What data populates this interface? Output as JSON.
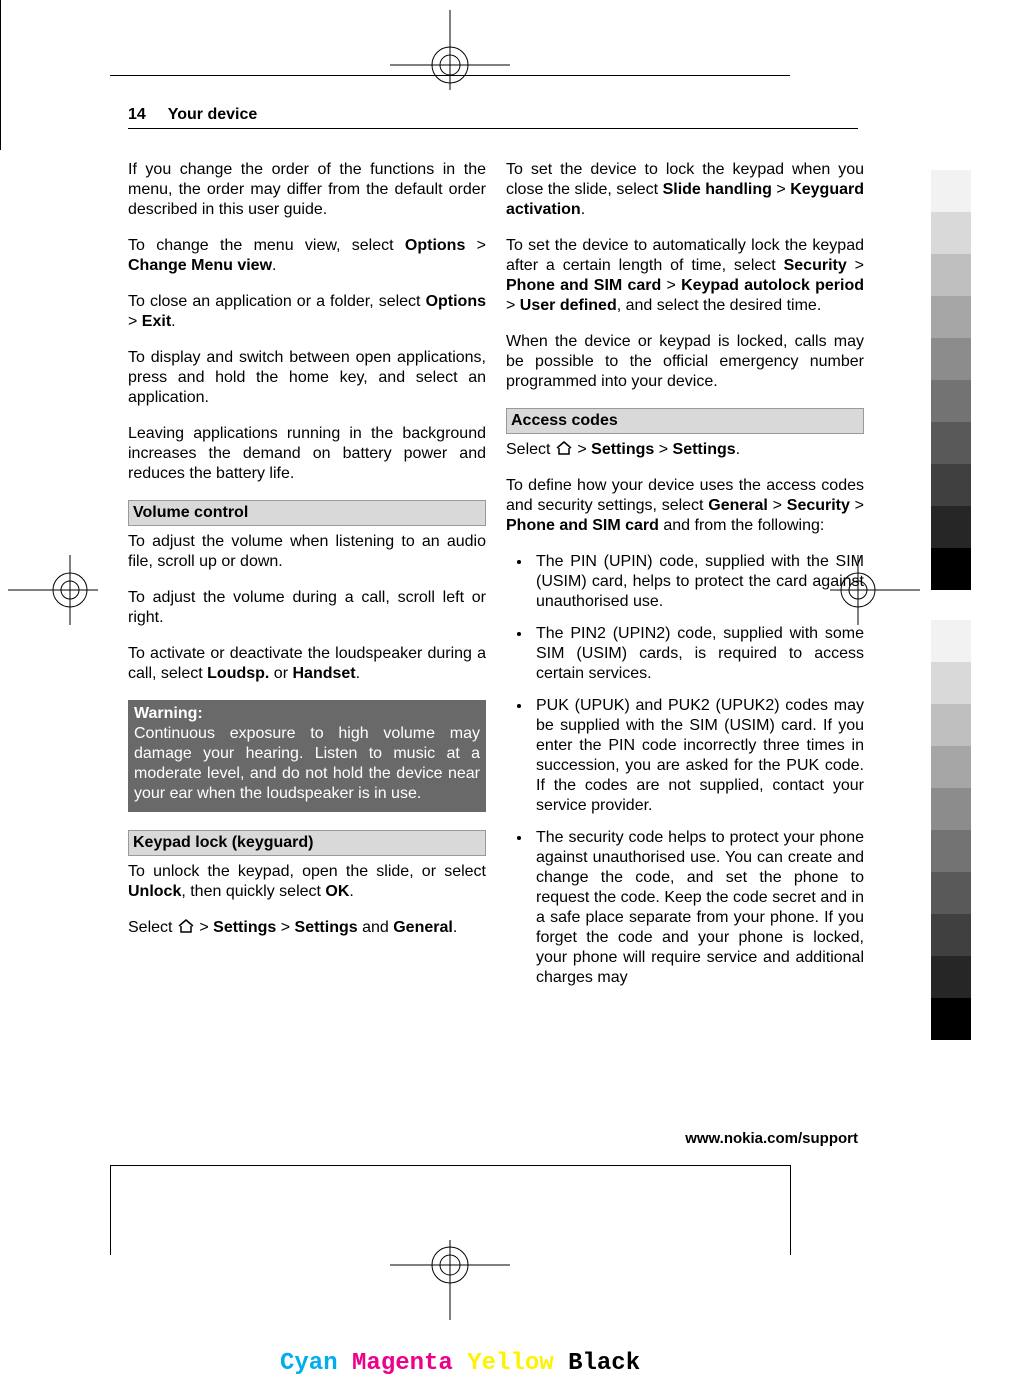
{
  "header": {
    "page_num": "14",
    "section": "Your device"
  },
  "col1": {
    "p1": "If you change the order of the functions in the menu, the order may differ from the default order described in this user guide.",
    "p2a": "To change the menu view, select ",
    "p2b": "Options",
    "p2c": " > ",
    "p2d": "Change Menu view",
    "p2e": ".",
    "p3a": "To close an application or a folder, select ",
    "p3b": "Options",
    "p3c": " > ",
    "p3d": "Exit",
    "p3e": ".",
    "p4": "To display and switch between open applications, press and hold the home key, and select an application.",
    "p5": "Leaving applications running in the background increases the demand on battery power and reduces the battery life.",
    "h_vol": "Volume control",
    "p6": "To adjust the volume when listening to an audio file, scroll up or down.",
    "p7": "To adjust the volume during a call, scroll left or right.",
    "p8a": "To activate or deactivate the loudspeaker during a call, select ",
    "p8b": "Loudsp.",
    "p8c": " or ",
    "p8d": "Handset",
    "p8e": ".",
    "warn_title": "Warning:",
    "warn_body": "Continuous exposure to high volume may damage your hearing. Listen to music at a moderate level, and do not hold the device near your ear when the loudspeaker is in use.",
    "h_key": "Keypad lock (keyguard)",
    "p9a": "To unlock the keypad, open the slide, or select ",
    "p9b": "Unlock",
    "p9c": ", then quickly select ",
    "p9d": "OK",
    "p9e": ".",
    "p10a": "Select ",
    "p10b": " > ",
    "p10c": "Settings",
    "p10d": " > ",
    "p10e": "Settings",
    "p10f": " and ",
    "p10g": "General",
    "p10h": "."
  },
  "col2": {
    "p1a": "To set the device to lock the keypad when you close the slide, select ",
    "p1b": "Slide handling",
    "p1c": " > ",
    "p1d": "Keyguard activation",
    "p1e": ".",
    "p2a": "To set the device to automatically lock the keypad after a certain length of time, select ",
    "p2b": "Security",
    "p2c": " > ",
    "p2d": "Phone and SIM card",
    "p2e": " > ",
    "p2f": "Keypad autolock period",
    "p2g": " > ",
    "p2h": "User defined",
    "p2i": ", and select the desired time.",
    "p3": "When the device or keypad is locked, calls may be possible to the official emergency number programmed into your device.",
    "h_acc": "Access codes",
    "p4a": "Select ",
    "p4b": " > ",
    "p4c": "Settings",
    "p4d": " > ",
    "p4e": "Settings",
    "p4f": ".",
    "p5a": "To define how your device uses the access codes and security settings, select ",
    "p5b": "General",
    "p5c": " > ",
    "p5d": "Security",
    "p5e": " > ",
    "p5f": "Phone and SIM card",
    "p5g": " and from the following:",
    "li1": "The PIN (UPIN) code, supplied with the SIM (USIM) card, helps to protect the card against unauthorised use.",
    "li2": "The PIN2 (UPIN2) code, supplied with some SIM (USIM) cards, is required to access certain services.",
    "li3": "PUK (UPUK) and PUK2 (UPUK2) codes may be supplied with the SIM (USIM) card. If you enter the PIN code incorrectly three times in succession, you are asked for the PUK code. If the codes are not supplied, contact your service provider.",
    "li4": "The security code helps to protect your phone against unauthorised use. You can create and change the code, and set the phone to request the code. Keep the code secret and in a safe place separate from your phone. If you forget the code and your phone is locked, your phone will require service and additional charges may"
  },
  "footer_url": "www.nokia.com/support",
  "cmyk": {
    "c": "Cyan",
    "m": "Magenta",
    "y": "Yellow",
    "k": "Black"
  },
  "colorbar": [
    "#e6e6e6",
    "#cccccc",
    "#b3b3b3",
    "#999999",
    "#808080",
    "#666666",
    "#4d4d4d",
    "#333333",
    "#1a1a1a",
    "#000000",
    "#e6e6e6",
    "#cccccc",
    "#b3b3b3",
    "#999999",
    "#808080",
    "#666666",
    "#4d4d4d",
    "#333333",
    "#1a1a1a",
    "#000000"
  ]
}
